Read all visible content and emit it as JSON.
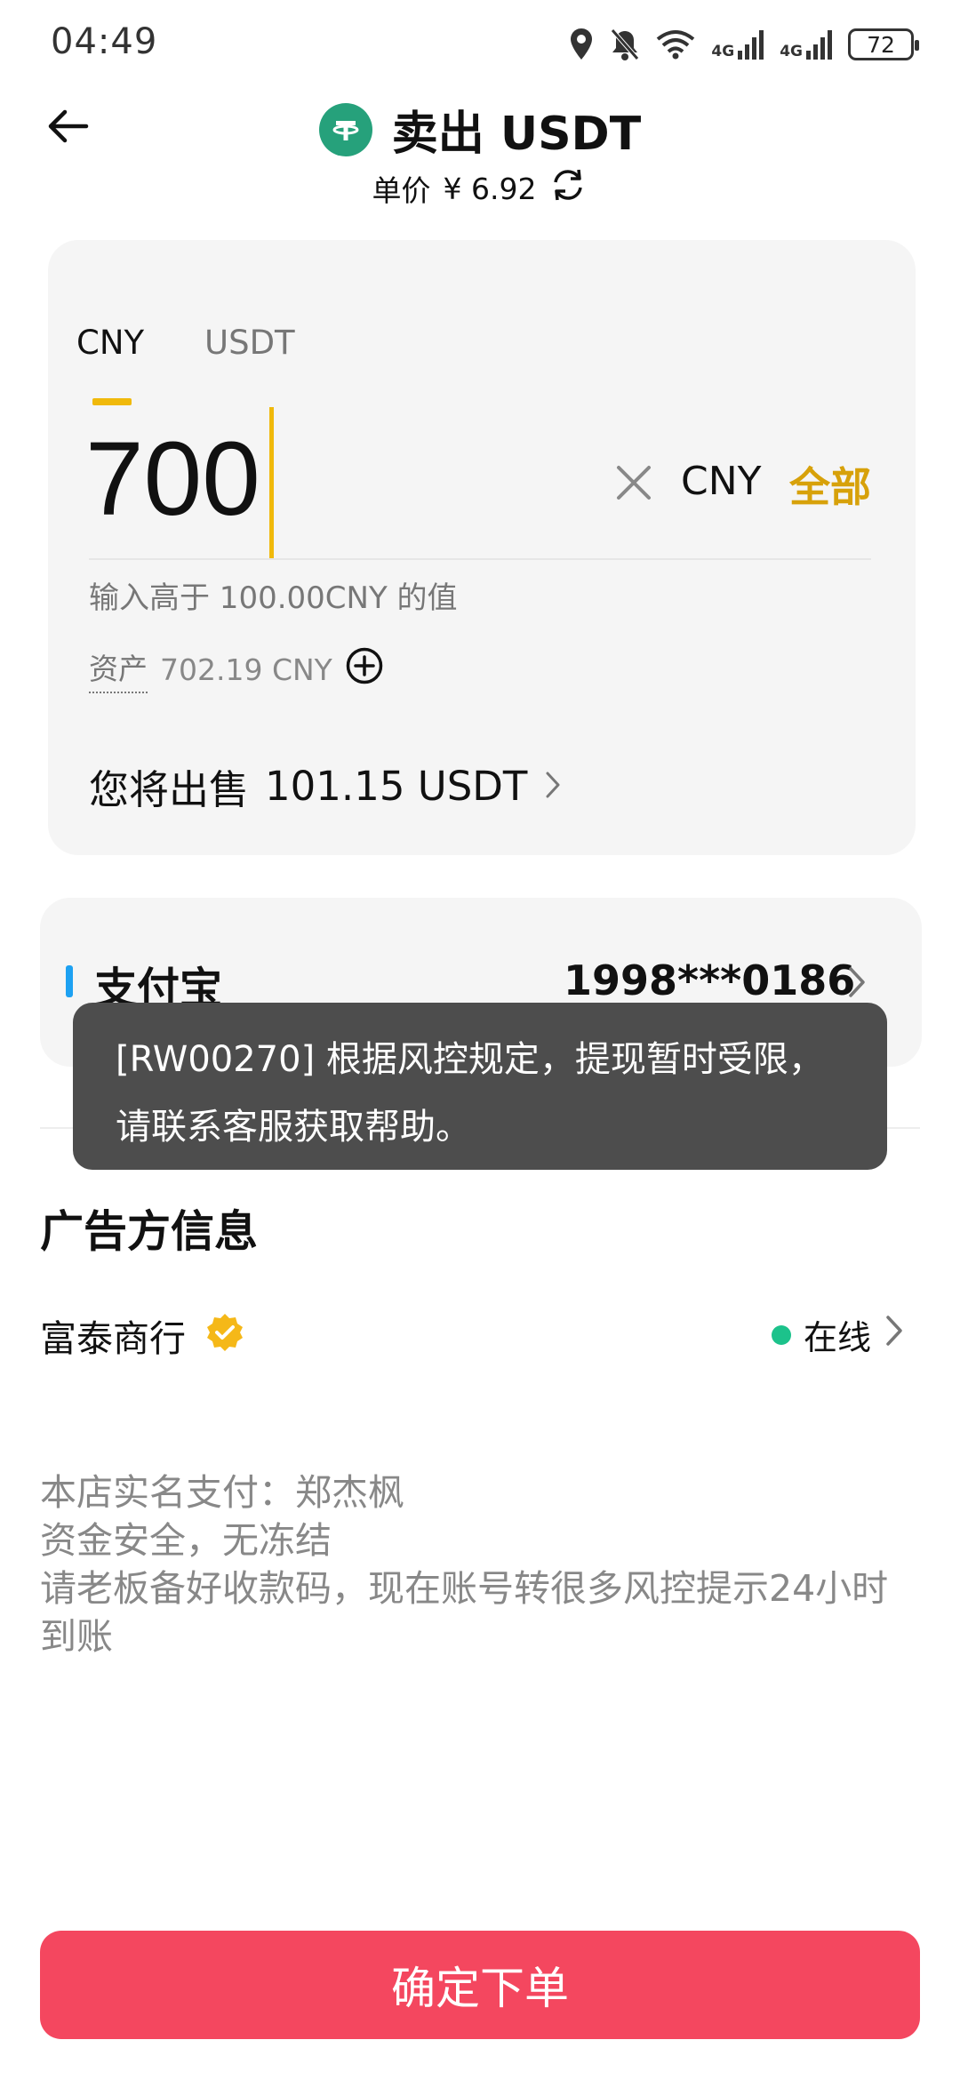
{
  "status_bar": {
    "time": "04:49",
    "network_1": "4G",
    "network_2": "4G",
    "battery": "72",
    "icons": [
      "location-icon",
      "bell-muted-icon",
      "wifi-icon",
      "signal-icon",
      "signal-icon",
      "battery-icon"
    ]
  },
  "header": {
    "title": "卖出 USDT",
    "token_icon": "usdt-token-icon",
    "price_label": "单价",
    "price_value": "¥ 6.92"
  },
  "amount_card": {
    "tabs": [
      {
        "label": "CNY",
        "active": true
      },
      {
        "label": "USDT",
        "active": false
      }
    ],
    "amount": "700",
    "unit": "CNY",
    "all_label": "全部",
    "hint": "输入高于 100.00CNY 的值",
    "asset_label": "资产",
    "asset_value": "702.19 CNY",
    "sell_label": "您将出售",
    "sell_value": "101.15 USDT"
  },
  "payment": {
    "method": "支付宝",
    "account": "1998***0186",
    "method_color": "#1da1f2"
  },
  "toast": {
    "line1": "[RW00270] 根据风控规定，提现暂时受限，",
    "line2": "请联系客服获取帮助。"
  },
  "advertiser": {
    "section_title": "广告方信息",
    "name": "富泰商行",
    "status": "在线",
    "status_color": "#1cc28b",
    "description": [
      "本店实名支付：郑杰枫",
      "资金安全，无冻结",
      "请老板备好收款码，现在账号转很多风控提示24小时",
      "到账"
    ]
  },
  "confirm_button": {
    "label": "确定下单",
    "color": "#f4475f"
  },
  "colors": {
    "accent": "#f0b90b",
    "all_text": "#d7a10a",
    "usdt": "#26a17b"
  }
}
